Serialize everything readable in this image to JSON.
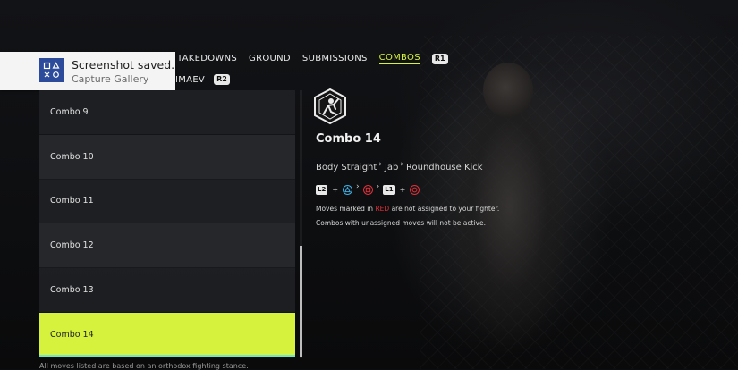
{
  "notification": {
    "title": "Screenshot saved.",
    "subtitle": "Capture Gallery",
    "icon": "ps-logo-icon"
  },
  "tabs": {
    "items": [
      {
        "label": "TAKEDOWNS",
        "active": false
      },
      {
        "label": "GROUND",
        "active": false
      },
      {
        "label": "SUBMISSIONS",
        "active": false
      },
      {
        "label": "COMBOS",
        "active": true
      }
    ],
    "next_button": "R1"
  },
  "fighter_row": {
    "name_partial": "IMAEV",
    "next_button": "R2"
  },
  "combo_list": {
    "items": [
      "Combo 9",
      "Combo 10",
      "Combo 11",
      "Combo 12",
      "Combo 13",
      "Combo 14"
    ],
    "selected_index": 5
  },
  "detail": {
    "title": "Combo 14",
    "moves": [
      "Body Straight",
      "Jab",
      "Roundhouse Kick"
    ],
    "inputs": {
      "l2": "L2",
      "l1": "L1"
    },
    "note_prefix": "Moves marked in ",
    "note_red": "RED",
    "note_suffix": " are not assigned to your fighter.",
    "note2": "Combos with unassigned moves will not be active."
  },
  "footer_note": "All moves listed are based on an orthodox fighting stance.",
  "colors": {
    "accent": "#d6f23d",
    "warning_red": "#e0303a",
    "notification_icon_bg": "#2c4b9b",
    "scroll_accent": "#6ee6c7"
  }
}
